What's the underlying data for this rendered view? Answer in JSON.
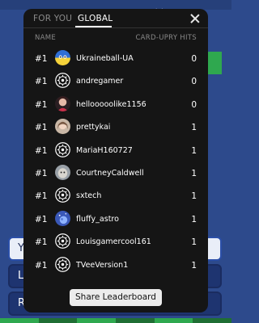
{
  "background": {
    "cards": [
      {
        "label": "Y"
      },
      {
        "label": "L"
      },
      {
        "label": "R"
      }
    ],
    "bottom_colors": [
      "#2fa84f",
      "#1f6e34",
      "#2fa84f",
      "#1f6e34",
      "#2fa84f",
      "#1f6e34"
    ]
  },
  "modal": {
    "tabs": [
      {
        "label": "FOR YOU",
        "active": false
      },
      {
        "label": "GLOBAL",
        "active": true
      }
    ],
    "columns": {
      "name": "NAME",
      "hits": "CARD-UPRY HITS"
    },
    "rows": [
      {
        "rank": "#1",
        "username": "Ukraineball-UA",
        "hits": "0",
        "avatar": "ukraine-ball"
      },
      {
        "rank": "#1",
        "username": "andregamer",
        "hits": "0",
        "avatar": "default-gear"
      },
      {
        "rank": "#1",
        "username": "hellooooolike1156",
        "hits": "0",
        "avatar": "photo-person"
      },
      {
        "rank": "#1",
        "username": "prettykai",
        "hits": "1",
        "avatar": "photo-person-light"
      },
      {
        "rank": "#1",
        "username": "MariaH160727",
        "hits": "1",
        "avatar": "default-gear"
      },
      {
        "rank": "#1",
        "username": "CourtneyCaldwell",
        "hits": "1",
        "avatar": "photo-animal"
      },
      {
        "rank": "#1",
        "username": "sxtech",
        "hits": "1",
        "avatar": "default-gear"
      },
      {
        "rank": "#1",
        "username": "fluffy_astro",
        "hits": "1",
        "avatar": "space-photo"
      },
      {
        "rank": "#1",
        "username": "Louisgamercool161",
        "hits": "1",
        "avatar": "default-gear"
      },
      {
        "rank": "#1",
        "username": "TVeeVersion1",
        "hits": "1",
        "avatar": "default-gear"
      }
    ],
    "share_label": "Share Leaderboard"
  }
}
